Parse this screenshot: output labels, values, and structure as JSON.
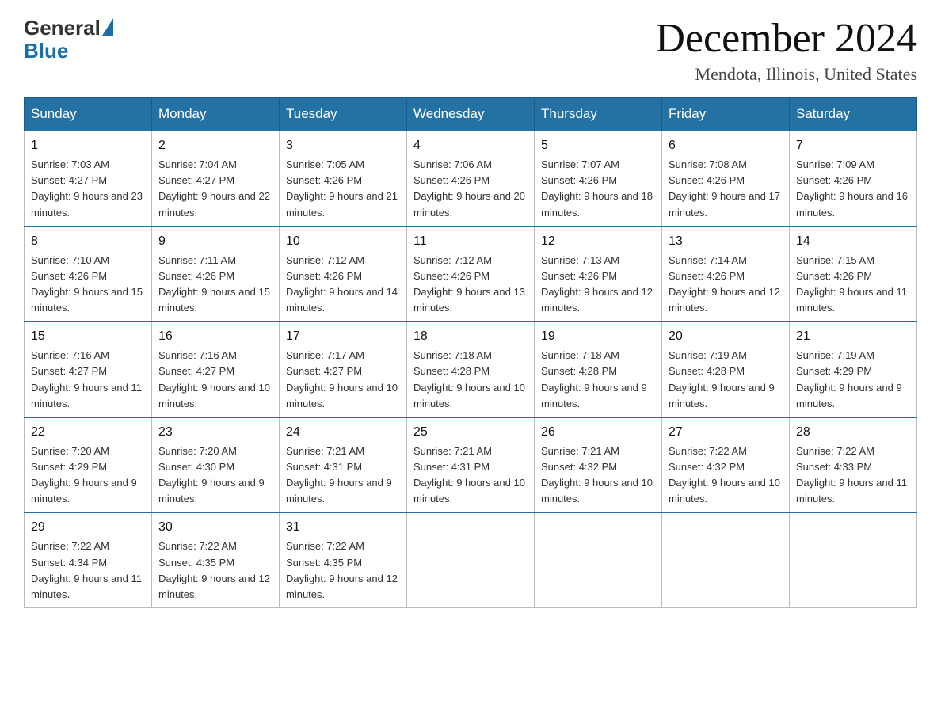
{
  "header": {
    "logo_general": "General",
    "logo_blue": "Blue",
    "title": "December 2024",
    "location": "Mendota, Illinois, United States"
  },
  "days_of_week": [
    "Sunday",
    "Monday",
    "Tuesday",
    "Wednesday",
    "Thursday",
    "Friday",
    "Saturday"
  ],
  "weeks": [
    [
      {
        "day": "1",
        "sunrise": "7:03 AM",
        "sunset": "4:27 PM",
        "daylight": "9 hours and 23 minutes."
      },
      {
        "day": "2",
        "sunrise": "7:04 AM",
        "sunset": "4:27 PM",
        "daylight": "9 hours and 22 minutes."
      },
      {
        "day": "3",
        "sunrise": "7:05 AM",
        "sunset": "4:26 PM",
        "daylight": "9 hours and 21 minutes."
      },
      {
        "day": "4",
        "sunrise": "7:06 AM",
        "sunset": "4:26 PM",
        "daylight": "9 hours and 20 minutes."
      },
      {
        "day": "5",
        "sunrise": "7:07 AM",
        "sunset": "4:26 PM",
        "daylight": "9 hours and 18 minutes."
      },
      {
        "day": "6",
        "sunrise": "7:08 AM",
        "sunset": "4:26 PM",
        "daylight": "9 hours and 17 minutes."
      },
      {
        "day": "7",
        "sunrise": "7:09 AM",
        "sunset": "4:26 PM",
        "daylight": "9 hours and 16 minutes."
      }
    ],
    [
      {
        "day": "8",
        "sunrise": "7:10 AM",
        "sunset": "4:26 PM",
        "daylight": "9 hours and 15 minutes."
      },
      {
        "day": "9",
        "sunrise": "7:11 AM",
        "sunset": "4:26 PM",
        "daylight": "9 hours and 15 minutes."
      },
      {
        "day": "10",
        "sunrise": "7:12 AM",
        "sunset": "4:26 PM",
        "daylight": "9 hours and 14 minutes."
      },
      {
        "day": "11",
        "sunrise": "7:12 AM",
        "sunset": "4:26 PM",
        "daylight": "9 hours and 13 minutes."
      },
      {
        "day": "12",
        "sunrise": "7:13 AM",
        "sunset": "4:26 PM",
        "daylight": "9 hours and 12 minutes."
      },
      {
        "day": "13",
        "sunrise": "7:14 AM",
        "sunset": "4:26 PM",
        "daylight": "9 hours and 12 minutes."
      },
      {
        "day": "14",
        "sunrise": "7:15 AM",
        "sunset": "4:26 PM",
        "daylight": "9 hours and 11 minutes."
      }
    ],
    [
      {
        "day": "15",
        "sunrise": "7:16 AM",
        "sunset": "4:27 PM",
        "daylight": "9 hours and 11 minutes."
      },
      {
        "day": "16",
        "sunrise": "7:16 AM",
        "sunset": "4:27 PM",
        "daylight": "9 hours and 10 minutes."
      },
      {
        "day": "17",
        "sunrise": "7:17 AM",
        "sunset": "4:27 PM",
        "daylight": "9 hours and 10 minutes."
      },
      {
        "day": "18",
        "sunrise": "7:18 AM",
        "sunset": "4:28 PM",
        "daylight": "9 hours and 10 minutes."
      },
      {
        "day": "19",
        "sunrise": "7:18 AM",
        "sunset": "4:28 PM",
        "daylight": "9 hours and 9 minutes."
      },
      {
        "day": "20",
        "sunrise": "7:19 AM",
        "sunset": "4:28 PM",
        "daylight": "9 hours and 9 minutes."
      },
      {
        "day": "21",
        "sunrise": "7:19 AM",
        "sunset": "4:29 PM",
        "daylight": "9 hours and 9 minutes."
      }
    ],
    [
      {
        "day": "22",
        "sunrise": "7:20 AM",
        "sunset": "4:29 PM",
        "daylight": "9 hours and 9 minutes."
      },
      {
        "day": "23",
        "sunrise": "7:20 AM",
        "sunset": "4:30 PM",
        "daylight": "9 hours and 9 minutes."
      },
      {
        "day": "24",
        "sunrise": "7:21 AM",
        "sunset": "4:31 PM",
        "daylight": "9 hours and 9 minutes."
      },
      {
        "day": "25",
        "sunrise": "7:21 AM",
        "sunset": "4:31 PM",
        "daylight": "9 hours and 10 minutes."
      },
      {
        "day": "26",
        "sunrise": "7:21 AM",
        "sunset": "4:32 PM",
        "daylight": "9 hours and 10 minutes."
      },
      {
        "day": "27",
        "sunrise": "7:22 AM",
        "sunset": "4:32 PM",
        "daylight": "9 hours and 10 minutes."
      },
      {
        "day": "28",
        "sunrise": "7:22 AM",
        "sunset": "4:33 PM",
        "daylight": "9 hours and 11 minutes."
      }
    ],
    [
      {
        "day": "29",
        "sunrise": "7:22 AM",
        "sunset": "4:34 PM",
        "daylight": "9 hours and 11 minutes."
      },
      {
        "day": "30",
        "sunrise": "7:22 AM",
        "sunset": "4:35 PM",
        "daylight": "9 hours and 12 minutes."
      },
      {
        "day": "31",
        "sunrise": "7:22 AM",
        "sunset": "4:35 PM",
        "daylight": "9 hours and 12 minutes."
      },
      null,
      null,
      null,
      null
    ]
  ]
}
